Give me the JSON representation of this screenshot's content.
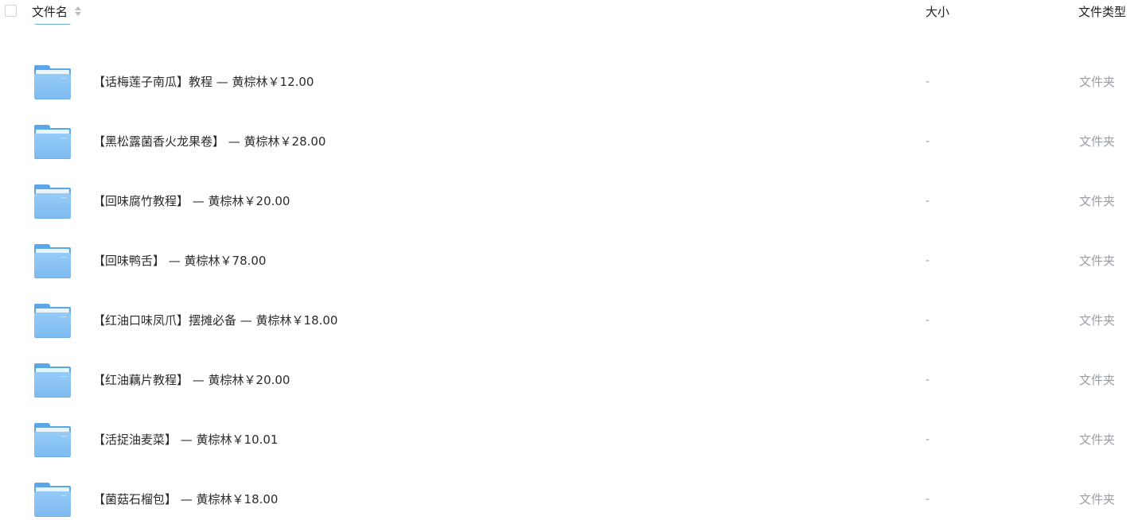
{
  "header": {
    "name_label": "文件名",
    "size_label": "大小",
    "type_label": "文件类型"
  },
  "partial_row": {
    "name": "",
    "size": "",
    "type": ""
  },
  "rows": [
    {
      "name": "【话梅莲子南瓜】教程 — 黄棕林￥12.00",
      "size": "-",
      "type": "文件夹"
    },
    {
      "name": "【黑松露菌香火龙果卷】 — 黄棕林￥28.00",
      "size": "-",
      "type": "文件夹"
    },
    {
      "name": "【回味腐竹教程】 — 黄棕林￥20.00",
      "size": "-",
      "type": "文件夹"
    },
    {
      "name": "【回味鸭舌】 — 黄棕林￥78.00",
      "size": "-",
      "type": "文件夹"
    },
    {
      "name": "【红油口味凤爪】摆摊必备 — 黄棕林￥18.00",
      "size": "-",
      "type": "文件夹"
    },
    {
      "name": "【红油藕片教程】 — 黄棕林￥20.00",
      "size": "-",
      "type": "文件夹"
    },
    {
      "name": "【活捉油麦菜】 — 黄棕林￥10.01",
      "size": "-",
      "type": "文件夹"
    },
    {
      "name": "【菌菇石榴包】 — 黄棕林￥18.00",
      "size": "-",
      "type": "文件夹"
    }
  ],
  "icons": {
    "folder": "folder-icon",
    "sort": "sort-icon",
    "checkbox": "select-all-checkbox"
  },
  "colors": {
    "folder_blue": "#5aa6ea",
    "folder_front": "#8cc5f5",
    "text_primary": "#2b2b2b",
    "text_muted": "#9a9ea5"
  }
}
